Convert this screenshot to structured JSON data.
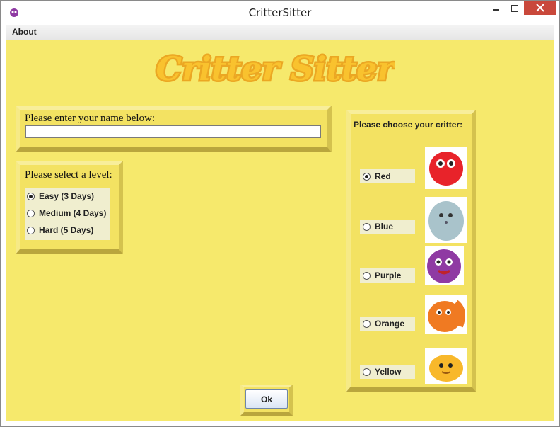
{
  "window": {
    "title": "CritterSitter"
  },
  "menu": {
    "about": "About"
  },
  "logo": {
    "text": "Critter Sitter"
  },
  "name_section": {
    "label": "Please enter your name below:",
    "value": ""
  },
  "level_section": {
    "label": "Please select a level:",
    "options": [
      {
        "label": "Easy (3 Days)",
        "selected": true
      },
      {
        "label": "Medium (4 Days)",
        "selected": false
      },
      {
        "label": "Hard (5 Days)",
        "selected": false
      }
    ]
  },
  "critter_section": {
    "label": "Please choose your critter:",
    "options": [
      {
        "label": "Red",
        "selected": true,
        "icon": "red-critter-image",
        "color": "#e8232a"
      },
      {
        "label": "Blue",
        "selected": false,
        "icon": "blue-critter-image",
        "color": "#a9c3cb"
      },
      {
        "label": "Purple",
        "selected": false,
        "icon": "purple-critter-image",
        "color": "#8f3aa3"
      },
      {
        "label": "Orange",
        "selected": false,
        "icon": "orange-critter-image",
        "color": "#f07a22"
      },
      {
        "label": "Yellow",
        "selected": false,
        "icon": "yellow-critter-image",
        "color": "#f8b82b"
      }
    ]
  },
  "ok_button": {
    "label": "Ok"
  },
  "colors": {
    "background": "#f6e96c",
    "panel": "#f3e262",
    "logo_fill": "#f9c22e"
  }
}
